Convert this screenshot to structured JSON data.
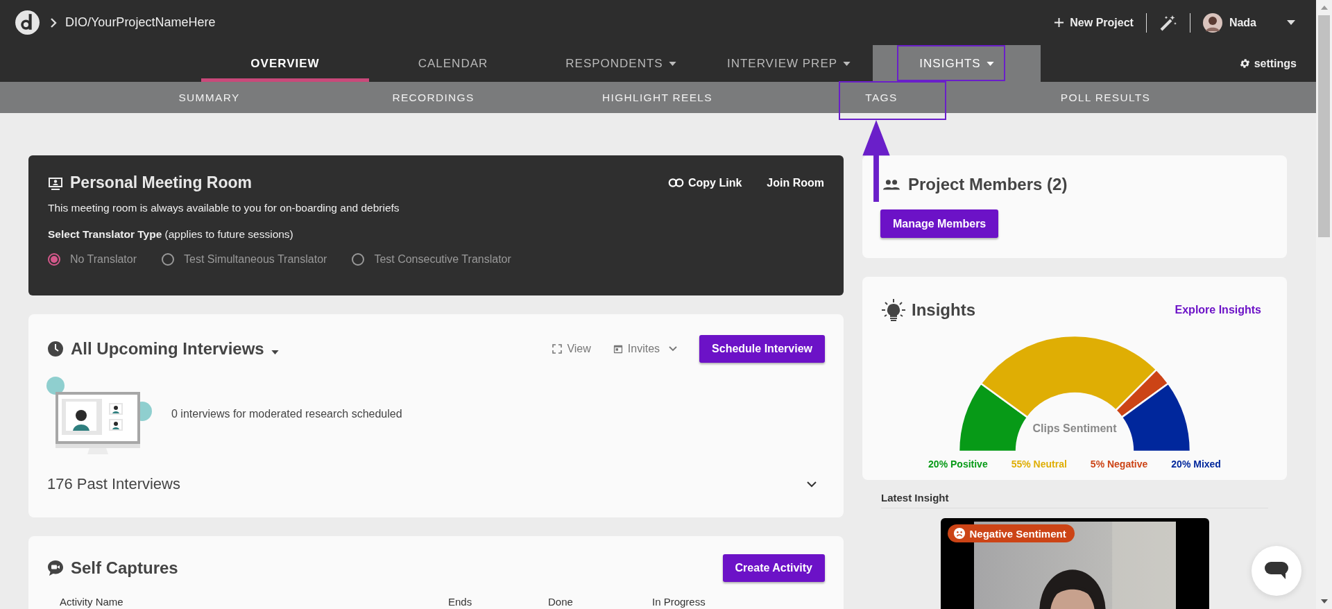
{
  "header": {
    "breadcrumb": "DIO/YourProjectNameHere",
    "new_project": "New Project",
    "user": "Nada"
  },
  "tabs": [
    {
      "label": "OVERVIEW",
      "selected": true,
      "dropdown": false,
      "expanded": false
    },
    {
      "label": "CALENDAR",
      "selected": false,
      "dropdown": false,
      "expanded": false
    },
    {
      "label": "RESPONDENTS",
      "selected": false,
      "dropdown": true,
      "expanded": false
    },
    {
      "label": "INTERVIEW PREP",
      "selected": false,
      "dropdown": true,
      "expanded": false
    },
    {
      "label": "INSIGHTS",
      "selected": false,
      "dropdown": true,
      "expanded": true
    }
  ],
  "settings": "settings",
  "subtabs": [
    "SUMMARY",
    "RECORDINGS",
    "HIGHLIGHT REELS",
    "TAGS",
    "POLL RESULTS"
  ],
  "meeting_room": {
    "title": "Personal Meeting Room",
    "description": "This meeting room is always available to you for on-boarding and debriefs",
    "copy_link": "Copy Link",
    "join_room": "Join Room",
    "translator": "**Select Translator Type** (applies to future sessions)",
    "options": [
      {
        "label": "No Translator",
        "selected": true
      },
      {
        "label": "Test Simultaneous Translator",
        "selected": false
      },
      {
        "label": "Test Consecutive Translator",
        "selected": false
      }
    ]
  },
  "upcoming": {
    "title": "All Upcoming Interviews",
    "view": "View",
    "invites": "Invites",
    "schedule": "Schedule Interview",
    "empty_text": "0 interviews for moderated research scheduled",
    "past": "176 Past Interviews"
  },
  "self_captures": {
    "title": "Self Captures",
    "create": "Create Activity",
    "columns": [
      "Activity Name",
      "Ends",
      "Done",
      "In Progress"
    ]
  },
  "project_members": {
    "title": "Project Members (2)",
    "manage": "Manage Members"
  },
  "insights": {
    "title": "Insights",
    "explore": "Explore Insights",
    "chart_data": {
      "type": "donut",
      "title": "Clips Sentiment",
      "values": [
        20,
        55,
        5,
        20
      ]
    },
    "legend": [
      {
        "label": "20% Positive",
        "color": "#079a17"
      },
      {
        "label": "55% Neutral",
        "color": "#dfae04"
      },
      {
        "label": "5% Negative",
        "color": "#cc4416"
      },
      {
        "label": "20% Mixed",
        "color": "#00279c"
      }
    ],
    "latest_label": "Latest Insight",
    "latest": {
      "kind": "picture",
      "badge": "Negative Sentiment"
    }
  }
}
